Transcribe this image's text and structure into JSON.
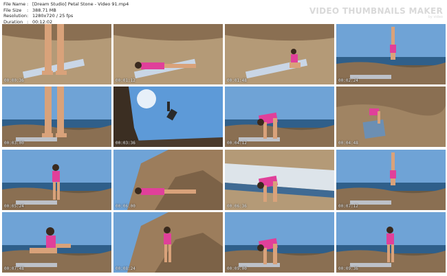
{
  "file_info": {
    "file_name_label": "File Name",
    "file_name_value": "[Dream Studio] Petal Stone - Video 91.mp4",
    "file_size_label": "File Size",
    "file_size_value": "388.71 MB",
    "resolution_label": "Resolution",
    "resolution_value": "1280x720 / 25 fps",
    "duration_label": "Duration",
    "duration_value": "00:12:02",
    "separator": ":"
  },
  "brand": {
    "title": "VIDEO THUMBNAILS MAKER",
    "subtitle": "by video"
  },
  "thumbnails": [
    {
      "time": "00:00:36",
      "scene": "sand",
      "figure": "standing-legs"
    },
    {
      "time": "00:01:12",
      "scene": "sand",
      "figure": "lying"
    },
    {
      "time": "00:01:48",
      "scene": "sand",
      "figure": "kneel-far"
    },
    {
      "time": "00:02:24",
      "scene": "sea",
      "figure": "handstand"
    },
    {
      "time": "00:03:00",
      "scene": "sea",
      "figure": "standing-legs"
    },
    {
      "time": "00:03:36",
      "scene": "sun",
      "figure": "jump"
    },
    {
      "time": "00:04:12",
      "scene": "sea",
      "figure": "bend"
    },
    {
      "time": "00:04:48",
      "scene": "rocks",
      "figure": "bend-small"
    },
    {
      "time": "00:05:24",
      "scene": "sea",
      "figure": "standing"
    },
    {
      "time": "00:06:00",
      "scene": "cliff",
      "figure": "lying"
    },
    {
      "time": "00:06:36",
      "scene": "mat",
      "figure": "bend"
    },
    {
      "time": "00:07:12",
      "scene": "sea",
      "figure": "handstand"
    },
    {
      "time": "00:07:48",
      "scene": "sea",
      "figure": "sitting"
    },
    {
      "time": "00:08:24",
      "scene": "cliff",
      "figure": "standing"
    },
    {
      "time": "00:09:00",
      "scene": "sea",
      "figure": "bend"
    },
    {
      "time": "00:09:36",
      "scene": "sea",
      "figure": "standing"
    }
  ],
  "colors": {
    "sky": "#6fa3d6",
    "sea": "#2f5f8a",
    "rock": "#8a6f52",
    "sand": "#b49a77",
    "shirt": "#e0409a",
    "skin": "#d9a27a",
    "mat": "#c9d6e6"
  }
}
